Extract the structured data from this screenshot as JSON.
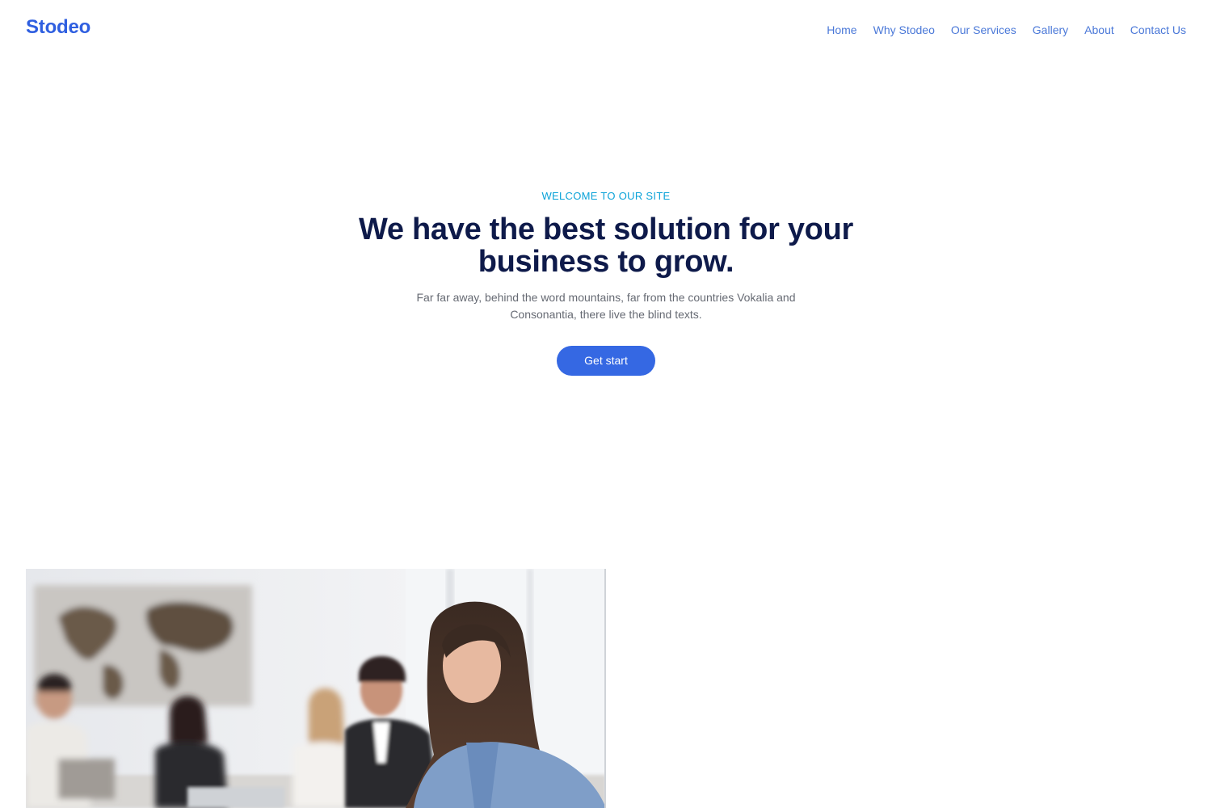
{
  "header": {
    "logo": "Stodeo",
    "nav": [
      "Home",
      "Why Stodeo",
      "Our Services",
      "Gallery",
      "About",
      "Contact Us"
    ]
  },
  "hero": {
    "eyebrow": "WELCOME TO OUR SITE",
    "headline": "We have the best solution for your business to grow.",
    "subtext": "Far far away, behind the word mountains, far from the countries Vokalia and Consonantia, there live the blind texts.",
    "cta_label": "Get start"
  },
  "colors": {
    "brand": "#2f5fe0",
    "nav_link": "#4a78d8",
    "eyebrow": "#0aa2d8",
    "headline": "#0e1a4a",
    "body_text": "#666a73",
    "button": "#3568e3"
  }
}
